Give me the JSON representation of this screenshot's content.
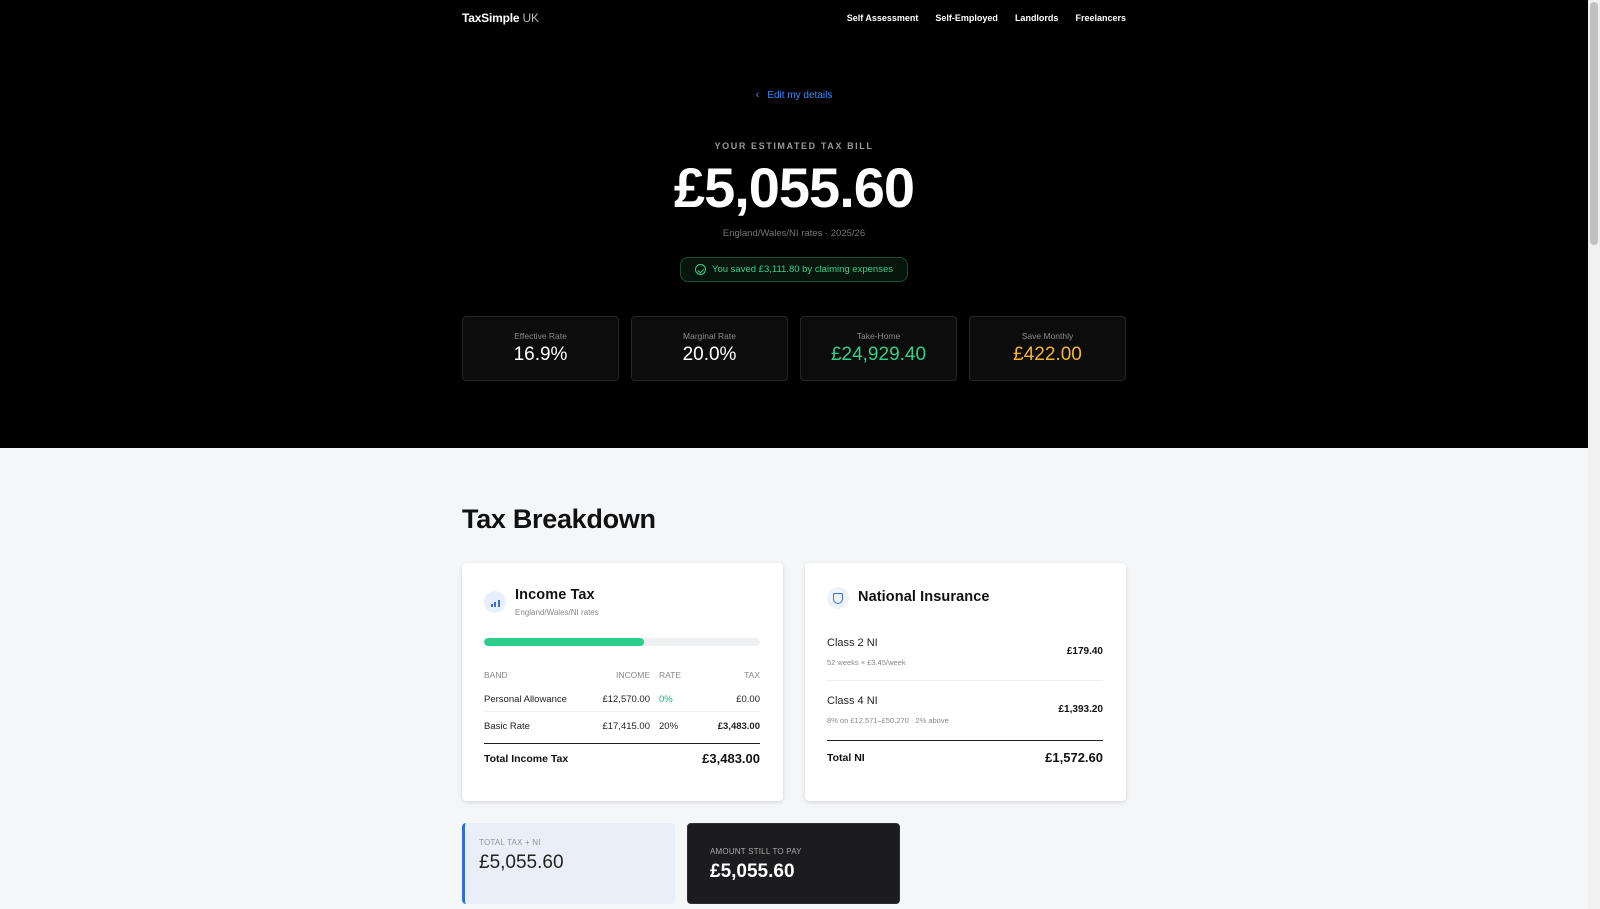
{
  "nav": {
    "brand": "TaxSimple",
    "brand_suffix": "UK",
    "links": [
      "Self Assessment",
      "Self-Employed",
      "Landlords",
      "Freelancers"
    ]
  },
  "hero": {
    "edit_link": "Edit my details",
    "estimate_label": "YOUR ESTIMATED TAX BILL",
    "amount": "£5,055.60",
    "subtitle": "England/Wales/NI rates · 2025/26",
    "saved": "You saved £3,111.80 by claiming expenses"
  },
  "stats": [
    {
      "label": "Effective Rate",
      "value": "16.9%",
      "color": "#ffffff"
    },
    {
      "label": "Marginal Rate",
      "value": "20.0%",
      "color": "#ffffff"
    },
    {
      "label": "Take-Home",
      "value": "£24,929.40",
      "color": "#2fd08b"
    },
    {
      "label": "Save Monthly",
      "value": "£422.00",
      "color": "#f5b52a"
    }
  ],
  "breakdown": {
    "title": "Tax Breakdown",
    "income_tax": {
      "title": "Income Tax",
      "subtitle": "England/Wales/NI rates",
      "progress_fraction": 0.58,
      "headers": {
        "band": "BAND",
        "income": "INCOME",
        "rate": "RATE",
        "tax": "TAX"
      },
      "rows": [
        {
          "band": "Personal Allowance",
          "income": "£12,570.00",
          "rate": "0%",
          "tax": "£0.00"
        },
        {
          "band": "Basic Rate",
          "income": "£17,415.00",
          "rate": "20%",
          "tax": "£3,483.00"
        }
      ],
      "total_label": "Total Income Tax",
      "total_value": "£3,483.00"
    },
    "national_insurance": {
      "title": "National Insurance",
      "rows": [
        {
          "name": "Class 2 NI",
          "detail": "52 weeks × £3.45/week",
          "value": "£179.40"
        },
        {
          "name": "Class 4 NI",
          "detail": "8% on £12,571–£50,270 · 2% above",
          "value": "£1,393.20"
        }
      ],
      "total_label": "Total NI",
      "total_value": "£1,572.60"
    }
  },
  "summary": {
    "total_label": "TOTAL TAX + NI",
    "total_value": "£5,055.60",
    "due_label": "AMOUNT STILL TO PAY",
    "due_value": "£5,055.60"
  }
}
